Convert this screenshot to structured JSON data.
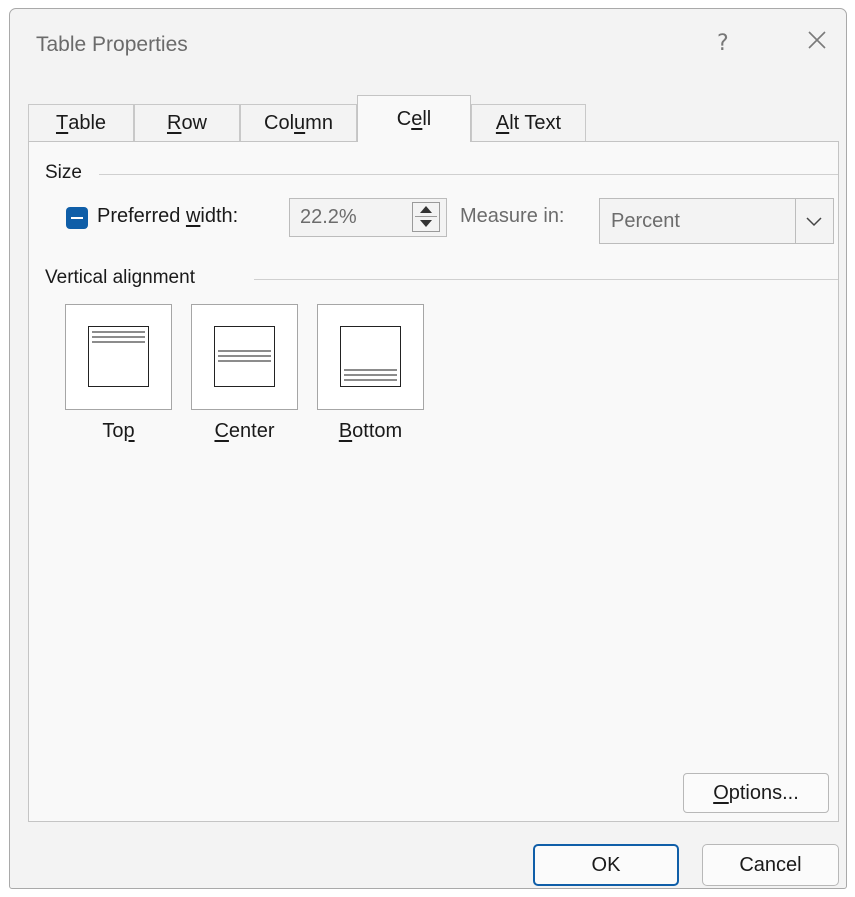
{
  "window": {
    "title": "Table Properties",
    "help_glyph": "?"
  },
  "tabs": [
    {
      "pre": "",
      "u": "T",
      "post": "able"
    },
    {
      "pre": "",
      "u": "R",
      "post": "ow"
    },
    {
      "pre": "Col",
      "u": "u",
      "post": "mn"
    },
    {
      "pre": "C",
      "u": "e",
      "post": "ll"
    },
    {
      "pre": "",
      "u": "A",
      "post": "lt Text"
    }
  ],
  "active_tab_index": 3,
  "size": {
    "group_label": "Size",
    "preferred_width": {
      "pre": "Preferred ",
      "u": "w",
      "post": "idth:",
      "value": "22.2%",
      "checkbox_state": "indeterminate"
    },
    "measure_in": {
      "label": "Measure in:",
      "value": "Percent"
    }
  },
  "vertical_alignment": {
    "group_label": "Vertical alignment",
    "options": [
      {
        "pre": "To",
        "u": "p",
        "post": ""
      },
      {
        "pre": "",
        "u": "C",
        "post": "enter"
      },
      {
        "pre": "",
        "u": "B",
        "post": "ottom"
      }
    ]
  },
  "options_button": {
    "u": "O",
    "post": "ptions..."
  },
  "footer": {
    "ok": "OK",
    "cancel": "Cancel"
  },
  "colors": {
    "accent": "#0f5ea8",
    "panel_bg": "#f9f9f9",
    "dialog_bg": "#f3f3f3"
  }
}
